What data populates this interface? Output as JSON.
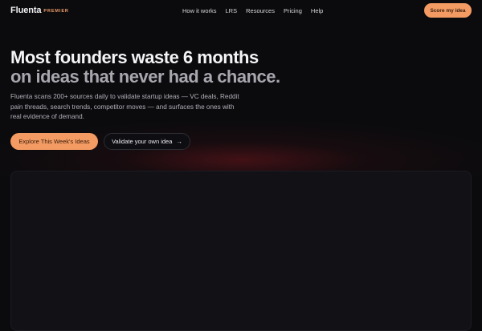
{
  "nav": {
    "brand": "Fluenta",
    "tier": "PREMIER",
    "links": [
      "How it works",
      "LRS",
      "Resources",
      "Pricing",
      "Help"
    ],
    "cta": "Score my idea"
  },
  "hero": {
    "title_line1": "Most founders waste 6 months",
    "title_line2": "on ideas that never had a chance.",
    "description": "Fluenta scans 200+ sources daily to validate startup ideas — VC deals, Reddit pain threads, search trends, competitor moves — and surfaces the ones with real evidence of demand.",
    "primary_cta": "Explore This Week's Ideas",
    "secondary_cta": "Validate your own idea",
    "secondary_cta_icon": "→"
  },
  "colors": {
    "accent": "#f39b62",
    "background": "#0b0b0e",
    "panel": "#111116",
    "glow": "#6e161c"
  }
}
